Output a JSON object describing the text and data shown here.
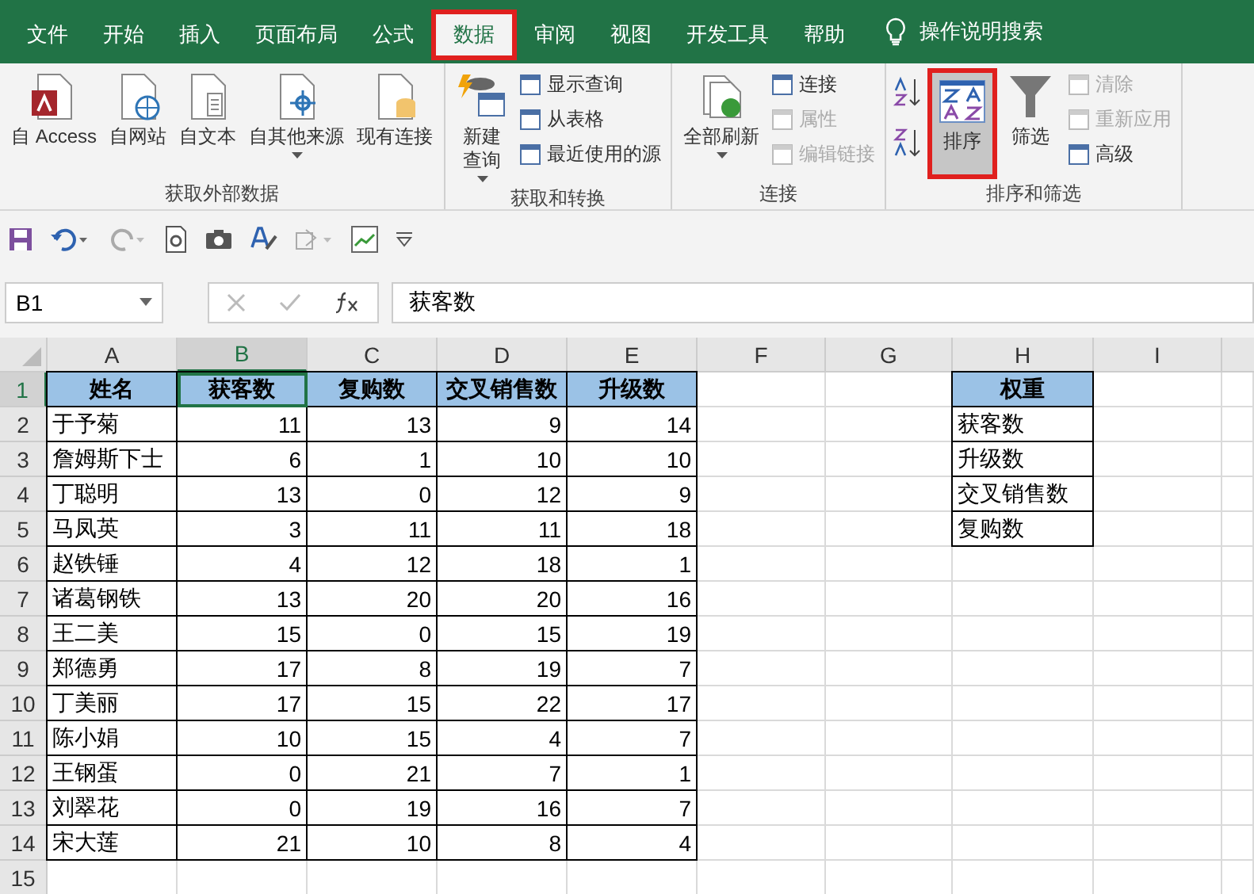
{
  "tabs": [
    {
      "label": "文件",
      "selected": false,
      "highlighted": false
    },
    {
      "label": "开始",
      "selected": false,
      "highlighted": false
    },
    {
      "label": "插入",
      "selected": false,
      "highlighted": false
    },
    {
      "label": "页面布局",
      "selected": false,
      "highlighted": false
    },
    {
      "label": "公式",
      "selected": false,
      "highlighted": false
    },
    {
      "label": "数据",
      "selected": true,
      "highlighted": true
    },
    {
      "label": "审阅",
      "selected": false,
      "highlighted": false
    },
    {
      "label": "视图",
      "selected": false,
      "highlighted": false
    },
    {
      "label": "开发工具",
      "selected": false,
      "highlighted": false
    },
    {
      "label": "帮助",
      "selected": false,
      "highlighted": false
    }
  ],
  "tell_me": "操作说明搜索",
  "ribbon_groups": [
    {
      "label": "获取外部数据",
      "buttons": [
        {
          "kind": "large",
          "label": "自 Access",
          "dropdown": false
        },
        {
          "kind": "large",
          "label": "自网站",
          "dropdown": false
        },
        {
          "kind": "large",
          "label": "自文本",
          "dropdown": false
        },
        {
          "kind": "large",
          "label": "自其他来源",
          "dropdown": true
        },
        {
          "kind": "large",
          "label": "现有连接",
          "dropdown": false
        }
      ]
    },
    {
      "label": "获取和转换",
      "buttons": [
        {
          "kind": "large",
          "label": "新建查询",
          "dropdown": true,
          "wrap": true
        },
        {
          "kind": "small",
          "label": "显示查询",
          "disabled": false
        },
        {
          "kind": "small",
          "label": "从表格",
          "disabled": false
        },
        {
          "kind": "small",
          "label": "最近使用的源",
          "disabled": false
        }
      ]
    },
    {
      "label": "连接",
      "buttons": [
        {
          "kind": "large",
          "label": "全部刷新",
          "dropdown": true
        },
        {
          "kind": "small",
          "label": "连接",
          "disabled": false
        },
        {
          "kind": "small",
          "label": "属性",
          "disabled": true
        },
        {
          "kind": "small",
          "label": "编辑链接",
          "disabled": true
        }
      ]
    },
    {
      "label": "排序和筛选",
      "buttons": [
        {
          "kind": "sorticons"
        },
        {
          "kind": "large",
          "label": "排序",
          "dropdown": false,
          "selected": true,
          "highlighted": true
        },
        {
          "kind": "large",
          "label": "筛选",
          "dropdown": false,
          "selected": false,
          "highlighted": false
        },
        {
          "kind": "small",
          "label": "清除",
          "disabled": true
        },
        {
          "kind": "small",
          "label": "重新应用",
          "disabled": true
        },
        {
          "kind": "small",
          "label": "高级",
          "disabled": false
        }
      ]
    }
  ],
  "name_box": "B1",
  "formula": "获客数",
  "column_headers": [
    {
      "label": "A",
      "selected": false
    },
    {
      "label": "B",
      "selected": true
    },
    {
      "label": "C",
      "selected": false
    },
    {
      "label": "D",
      "selected": false
    },
    {
      "label": "E",
      "selected": false
    },
    {
      "label": "F",
      "selected": false
    },
    {
      "label": "G",
      "selected": false
    },
    {
      "label": "H",
      "selected": false
    },
    {
      "label": "I",
      "selected": false
    }
  ],
  "row_headers": [
    {
      "label": "1",
      "selected": true
    },
    {
      "label": "2",
      "selected": false
    },
    {
      "label": "3",
      "selected": false
    },
    {
      "label": "4",
      "selected": false
    },
    {
      "label": "5",
      "selected": false
    },
    {
      "label": "6",
      "selected": false
    },
    {
      "label": "7",
      "selected": false
    },
    {
      "label": "8",
      "selected": false
    },
    {
      "label": "9",
      "selected": false
    },
    {
      "label": "10",
      "selected": false
    },
    {
      "label": "11",
      "selected": false
    },
    {
      "label": "12",
      "selected": false
    },
    {
      "label": "13",
      "selected": false
    },
    {
      "label": "14",
      "selected": false
    },
    {
      "label": "15",
      "selected": false
    }
  ],
  "data_table": {
    "header": [
      "姓名",
      "获客数",
      "复购数",
      "交叉销售数",
      "升级数"
    ],
    "rows": [
      [
        "于予菊",
        "11",
        "13",
        "9",
        "14"
      ],
      [
        "詹姆斯下士",
        "6",
        "1",
        "10",
        "10"
      ],
      [
        "丁聪明",
        "13",
        "0",
        "12",
        "9"
      ],
      [
        "马凤英",
        "3",
        "11",
        "11",
        "18"
      ],
      [
        "赵铁锤",
        "4",
        "12",
        "18",
        "1"
      ],
      [
        "诸葛钢铁",
        "13",
        "20",
        "20",
        "16"
      ],
      [
        "王二美",
        "15",
        "0",
        "15",
        "19"
      ],
      [
        "郑德勇",
        "17",
        "8",
        "19",
        "7"
      ],
      [
        "丁美丽",
        "17",
        "15",
        "22",
        "17"
      ],
      [
        "陈小娟",
        "10",
        "15",
        "4",
        "7"
      ],
      [
        "王钢蛋",
        "0",
        "21",
        "7",
        "1"
      ],
      [
        "刘翠花",
        "0",
        "19",
        "16",
        "7"
      ],
      [
        "宋大莲",
        "21",
        "10",
        "8",
        "4"
      ]
    ]
  },
  "weights_table": {
    "header": "权重",
    "items": [
      "获客数",
      "升级数",
      "交叉销售数",
      "复购数"
    ]
  }
}
